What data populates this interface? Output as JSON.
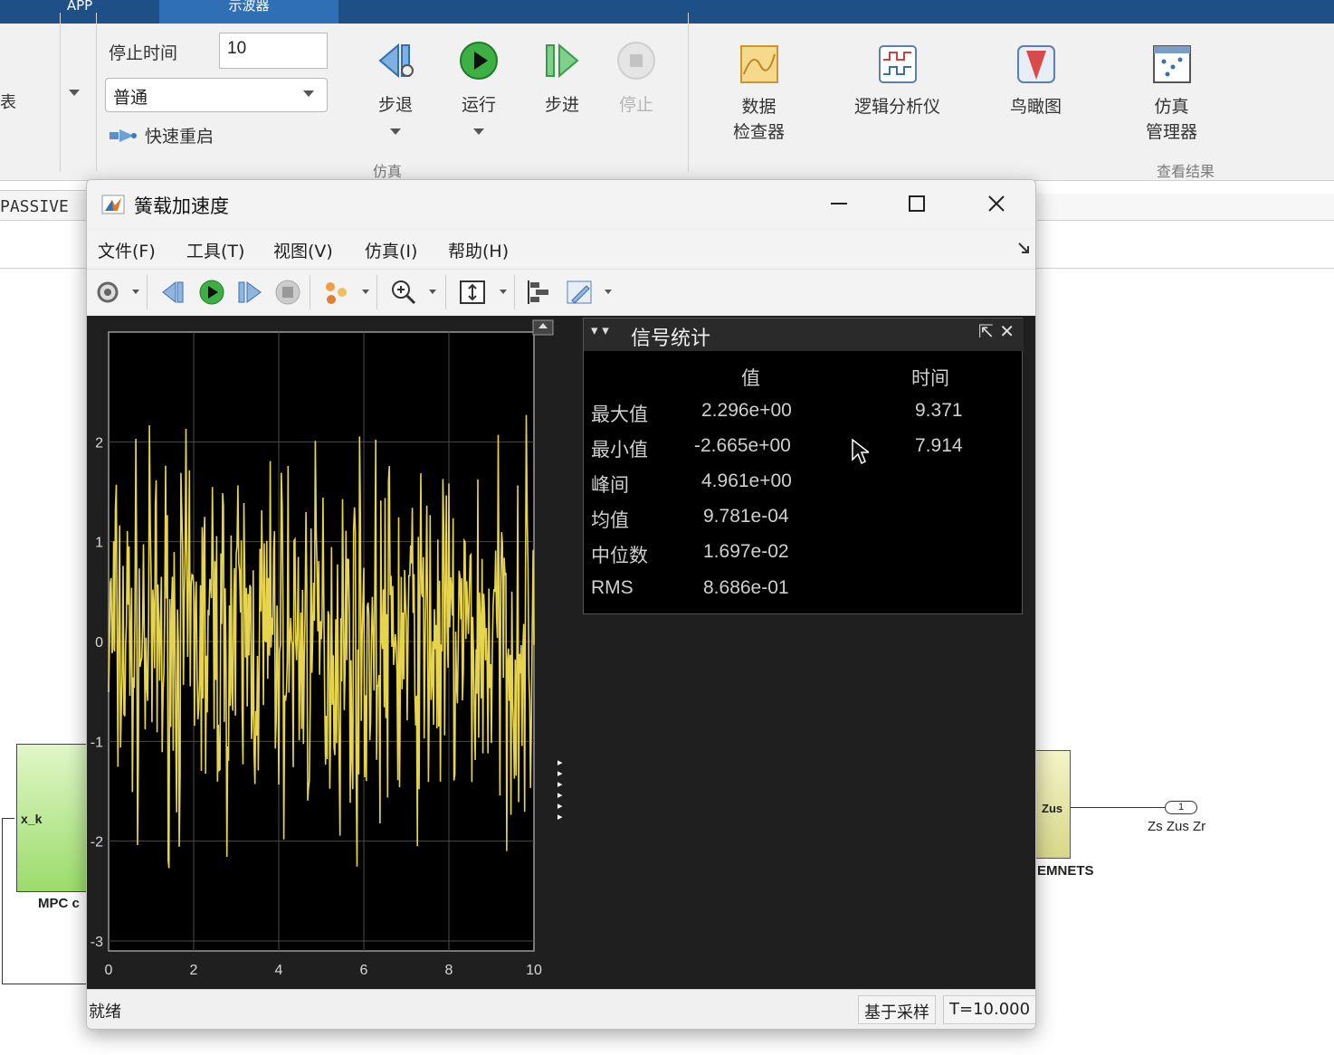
{
  "topbar": {
    "app_tab": "APP",
    "active_tab": "示波器"
  },
  "ribbon": {
    "left_cut_text": "表",
    "stop_time_label": "停止时间",
    "stop_time_value": "10",
    "mode_value": "普通",
    "fast_restart_label": "快速重启",
    "step_back": "步退",
    "run": "运行",
    "step_forward": "步进",
    "stop": "停止",
    "sim_group": "仿真",
    "data_inspector": [
      "数据",
      "检查器"
    ],
    "logic_analyzer": "逻辑分析仪",
    "birds_eye": "鸟瞰图",
    "sim_manager": [
      "仿真",
      "管理器"
    ],
    "results_group": "查看结果"
  },
  "model": {
    "passive": "PASSIVE",
    "mpc_port": "x_k",
    "mpc_label": "MPC c",
    "zus_port": "Zus",
    "zus_label": "EMNETS",
    "outport_num": "1",
    "outport_label": "Zs Zus Zr"
  },
  "scope": {
    "title": "簧载加速度",
    "menu": [
      "文件(F)",
      "工具(T)",
      "视图(V)",
      "仿真(I)",
      "帮助(H)"
    ],
    "status_left": "就绪",
    "status_sampling": "基于采样",
    "status_time": "T=10.000"
  },
  "stats": {
    "title": "信号统计",
    "col_value": "值",
    "col_time": "时间",
    "rows": [
      {
        "name": "最大值",
        "value": "2.296e+00",
        "time": "9.371"
      },
      {
        "name": "最小值",
        "value": "-2.665e+00",
        "time": "7.914"
      },
      {
        "name": "峰间",
        "value": "4.961e+00",
        "time": ""
      },
      {
        "name": "均值",
        "value": "9.781e-04",
        "time": ""
      },
      {
        "name": "中位数",
        "value": "1.697e-02",
        "time": ""
      },
      {
        "name": "RMS",
        "value": "8.686e-01",
        "time": ""
      }
    ]
  },
  "chart_data": {
    "type": "line",
    "xlim": [
      0,
      10
    ],
    "ylim": [
      -3.1,
      3.1
    ],
    "xticks": [
      "0",
      "2",
      "4",
      "6",
      "8",
      "10"
    ],
    "yticks": [
      "2",
      "1",
      "0",
      "-1",
      "-2",
      "-3"
    ],
    "grid": true,
    "series": [
      {
        "color": "#e6d44e",
        "seed": 7,
        "samples": 501
      }
    ]
  }
}
